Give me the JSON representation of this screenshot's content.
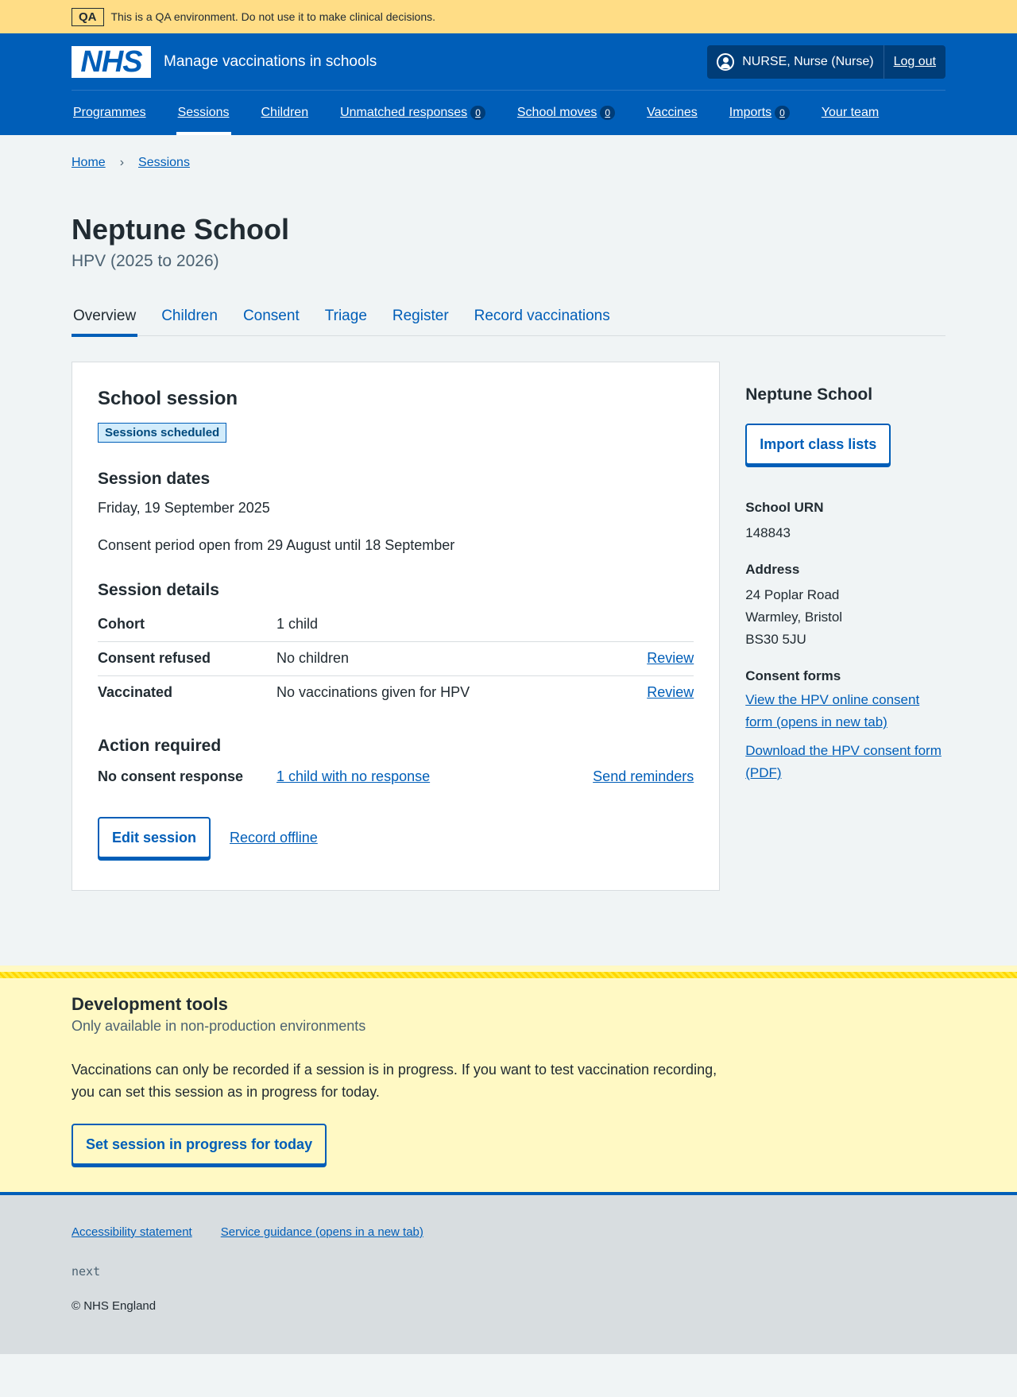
{
  "qa": {
    "tag": "QA",
    "text": "This is a QA environment. Do not use it to make clinical decisions."
  },
  "header": {
    "logo": "NHS",
    "service_name": "Manage vaccinations in schools",
    "user": "NURSE, Nurse (Nurse)",
    "logout": "Log out",
    "nav": [
      {
        "label": "Programmes"
      },
      {
        "label": "Sessions",
        "active": true
      },
      {
        "label": "Children"
      },
      {
        "label": "Unmatched responses",
        "count": "0"
      },
      {
        "label": "School moves",
        "count": "0"
      },
      {
        "label": "Vaccines"
      },
      {
        "label": "Imports",
        "count": "0"
      },
      {
        "label": "Your team"
      }
    ]
  },
  "breadcrumb": [
    "Home",
    "Sessions"
  ],
  "page": {
    "title": "Neptune School",
    "caption": "HPV (2025 to 2026)"
  },
  "tabs": [
    "Overview",
    "Children",
    "Consent",
    "Triage",
    "Register",
    "Record vaccinations"
  ],
  "card": {
    "title": "School session",
    "status": "Sessions scheduled",
    "dates_heading": "Session dates",
    "date": "Friday, 19 September 2025",
    "consent_period": "Consent period open from 29 August until 18 September",
    "details_heading": "Session details",
    "details": [
      {
        "key": "Cohort",
        "value": "1 child",
        "action": ""
      },
      {
        "key": "Consent refused",
        "value": "No children",
        "action": "Review"
      },
      {
        "key": "Vaccinated",
        "value": "No vaccinations given for HPV",
        "action": "Review"
      }
    ],
    "action_heading": "Action required",
    "action": {
      "key": "No consent response",
      "value": "1 child with no response",
      "link": "Send reminders"
    },
    "edit_button": "Edit session",
    "record_offline": "Record offline"
  },
  "side": {
    "title": "Neptune School",
    "import_button": "Import class lists",
    "urn_label": "School URN",
    "urn": "148843",
    "address_label": "Address",
    "address": [
      "24 Poplar Road",
      "Warmley, Bristol",
      "BS30 5JU"
    ],
    "forms_label": "Consent forms",
    "form_links": [
      "View the HPV online consent form (opens in new tab)",
      "Download the HPV consent form (PDF)"
    ]
  },
  "dev": {
    "title": "Development tools",
    "subtitle": "Only available in non-production environments",
    "text": "Vaccinations can only be recorded if a session is in progress. If you want to test vaccination recording, you can set this session as in progress for today.",
    "button": "Set session in progress for today"
  },
  "footer": {
    "links": [
      "Accessibility statement",
      "Service guidance (opens in a new tab)"
    ],
    "code": "next",
    "copyright": "© NHS England"
  }
}
